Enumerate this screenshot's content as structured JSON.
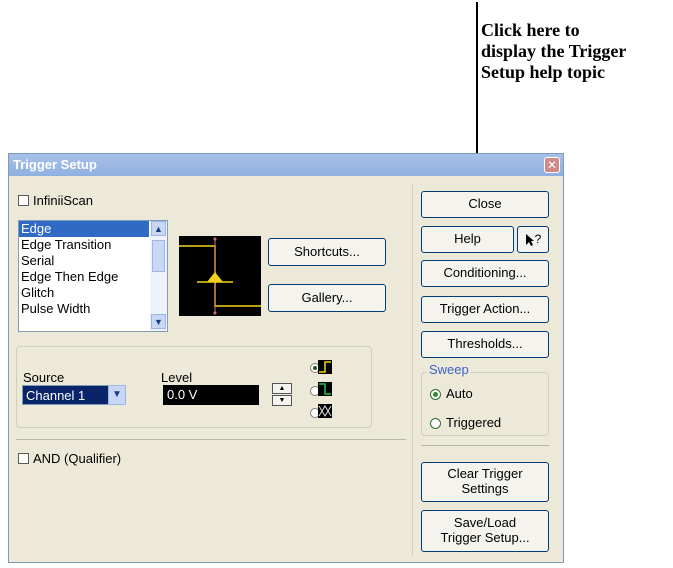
{
  "callout": {
    "lines": [
      "Click here to",
      "display the Trigger",
      "Setup help topic"
    ]
  },
  "window": {
    "title": "Trigger Setup",
    "close_glyph": "✕"
  },
  "infiniiscan_label": "InfiniiScan",
  "trigger_types": [
    "Edge",
    "Edge Transition",
    "Serial",
    "Edge Then Edge",
    "Glitch",
    "Pulse Width"
  ],
  "selected_trigger_type": "Edge",
  "buttons": {
    "shortcuts": "Shortcuts...",
    "gallery": "Gallery...",
    "close": "Close",
    "help": "Help",
    "whats_this_glyph": "?",
    "conditioning": "Conditioning...",
    "trigger_action": "Trigger Action...",
    "thresholds": "Thresholds...",
    "clear_trigger_line1": "Clear Trigger",
    "clear_trigger_line2": "Settings",
    "saveload_line1": "Save/Load",
    "saveload_line2": "Trigger Setup..."
  },
  "source": {
    "label": "Source",
    "value": "Channel 1"
  },
  "level": {
    "label": "Level",
    "value": "0.0 V"
  },
  "slope": {
    "selected": "rising",
    "options": [
      "rising",
      "falling",
      "either"
    ]
  },
  "sweep": {
    "label": "Sweep",
    "options": [
      "Auto",
      "Triggered"
    ],
    "selected": "Auto"
  },
  "qualifier_label": "AND (Qualifier)",
  "colors": {
    "selection": "#316ac5",
    "dialog_bg": "#ece9d8",
    "titlebar": "#8fb0e0",
    "trigger_marker": "#f5d21a",
    "sweep_title": "#3c64c8"
  }
}
